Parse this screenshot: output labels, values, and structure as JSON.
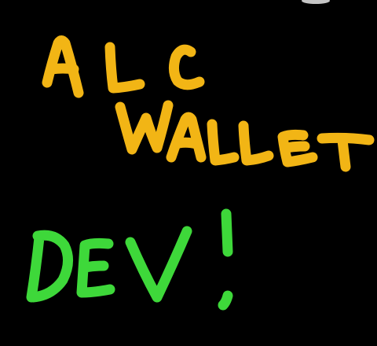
{
  "image": {
    "line1": "ALC",
    "line2": "WALLET",
    "line3": "DEV!",
    "colors": {
      "background": "#000000",
      "title_ink": "#f2b515",
      "subtitle_ink": "#3ed83a"
    }
  }
}
